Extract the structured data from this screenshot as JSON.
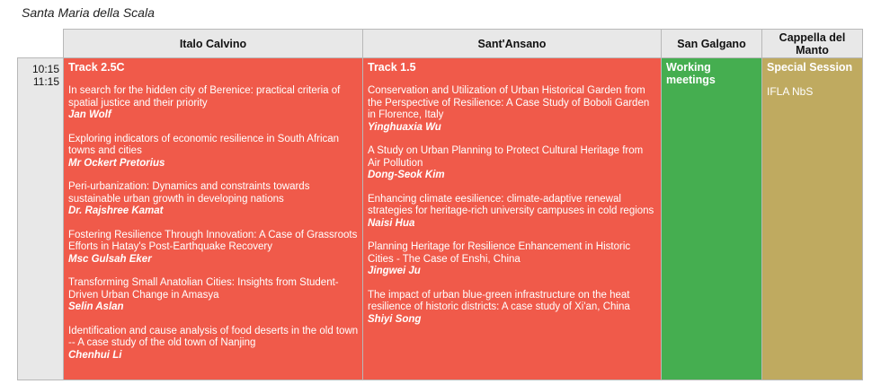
{
  "venue": "Santa Maria della Scala",
  "columns": [
    "Italo Calvino",
    "Sant'Ansano",
    "San Galgano",
    "Cappella del Manto"
  ],
  "time": {
    "start": "10:15",
    "end": "11:15"
  },
  "col1": {
    "track": "Track 2.5C",
    "talks": [
      {
        "title": "In search for the hidden city of Berenice: practical criteria of spatial justice and their priority",
        "author": "Jan Wolf"
      },
      {
        "title": "Exploring indicators of economic resilience in South African towns and cities",
        "author": "Mr Ockert Pretorius"
      },
      {
        "title": "Peri-urbanization: Dynamics and constraints towards sustainable urban growth in developing nations",
        "author": "Dr. Rajshree Kamat"
      },
      {
        "title": "Fostering Resilience Through Innovation: A Case of Grassroots Efforts in Hatay's Post-Earthquake Recovery",
        "author": "Msc Gulsah Eker"
      },
      {
        "title": "Transforming Small Anatolian Cities: Insights from Student-Driven Urban Change in Amasya",
        "author": "Selin Aslan"
      },
      {
        "title": "Identification and cause analysis of food deserts in the old town -- A case study of the old town of Nanjing",
        "author": "Chenhui Li"
      }
    ]
  },
  "col2": {
    "track": "Track 1.5",
    "talks": [
      {
        "title": "Conservation and Utilization of Urban Historical Garden from the Perspective of Resilience: A Case Study of Boboli Garden in Florence, Italy",
        "author": "Yinghuaxia Wu"
      },
      {
        "title": "A Study on Urban Planning to Protect Cultural Heritage from Air Pollution",
        "author": "Dong-Seok Kim"
      },
      {
        "title": "Enhancing climate eesilience: climate-adaptive renewal strategies for heritage-rich university campuses in cold regions",
        "author": "Naisi Hua"
      },
      {
        "title": "Planning Heritage for Resilience Enhancement in Historic Cities - The Case of Enshi, China",
        "author": "Jingwei Ju"
      },
      {
        "title": "The impact of urban blue-green infrastructure on the heat resilience of historic districts: A case study of Xi'an, China",
        "author": "Shiyi Song"
      }
    ]
  },
  "col3": {
    "track": "Working meetings"
  },
  "col4": {
    "track": "Special Session",
    "sub": "IFLA NbS"
  },
  "colors": {
    "red": "#f05a4a",
    "green": "#45ae50",
    "olive": "#bfaa60",
    "header": "#e8e8e8"
  }
}
